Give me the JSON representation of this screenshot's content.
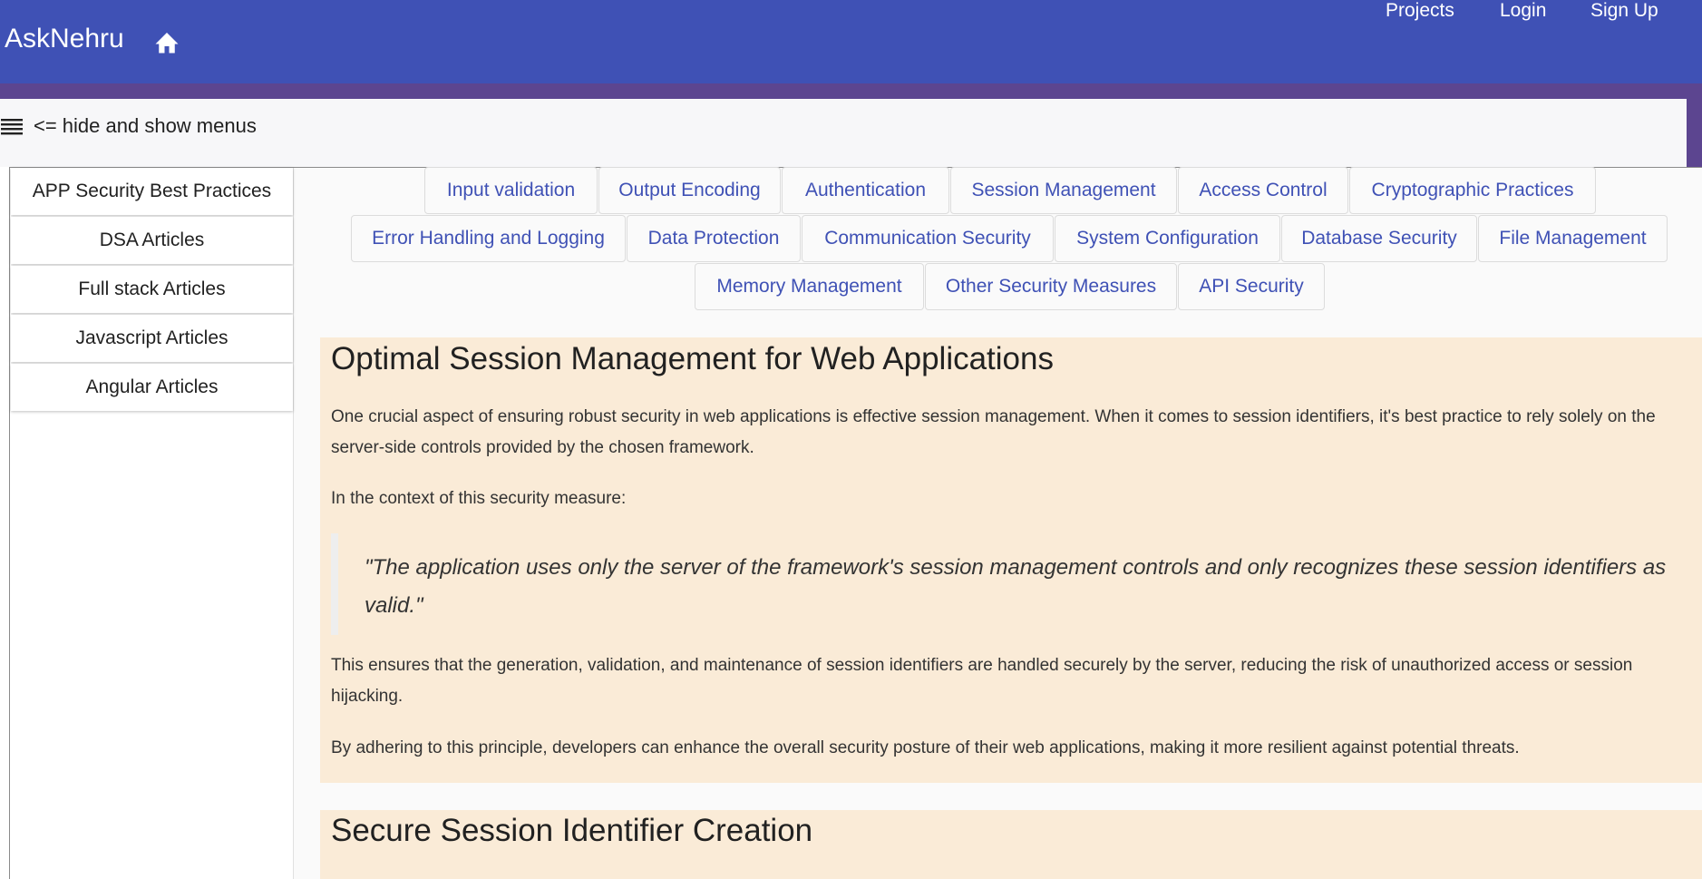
{
  "header": {
    "brand": "AskNehru",
    "home_icon": "home-icon",
    "nav": {
      "projects": "Projects",
      "login": "Login",
      "signup": "Sign Up"
    }
  },
  "menu_toggle": {
    "icon": "hamburger-icon",
    "label": "<= hide and show menus"
  },
  "sidebar": {
    "items": [
      "APP Security Best Practices",
      "DSA Articles",
      "Full stack Articles",
      "Javascript Articles",
      "Angular Articles"
    ]
  },
  "tabs": [
    "Input validation",
    "Output Encoding",
    "Authentication",
    "Session Management",
    "Access Control",
    "Cryptographic Practices",
    "Error Handling and Logging",
    "Data Protection",
    "Communication Security",
    "System Configuration",
    "Database Security",
    "File Management",
    "Memory Management",
    "Other Security Measures",
    "API Security"
  ],
  "article1": {
    "title": "Optimal Session Management for Web Applications",
    "p1": "One crucial aspect of ensuring robust security in web applications is effective session management. When it comes to session identifiers, it's best practice to rely solely on the server-side controls provided by the chosen framework.",
    "p2": "In the context of this security measure:",
    "quote": "\"The application uses only the server of the framework's session management controls and only recognizes these session identifiers as valid.\"",
    "p3": "This ensures that the generation, validation, and maintenance of session identifiers are handled securely by the server, reducing the risk of unauthorized access or session hijacking.",
    "p4": "By adhering to this principle, developers can enhance the overall security posture of their web applications, making it more resilient against potential threats."
  },
  "article2": {
    "title": "Secure Session Identifier Creation"
  },
  "colors": {
    "primary": "#3f51b5",
    "band": "#5c4590",
    "card": "#faebd7"
  }
}
